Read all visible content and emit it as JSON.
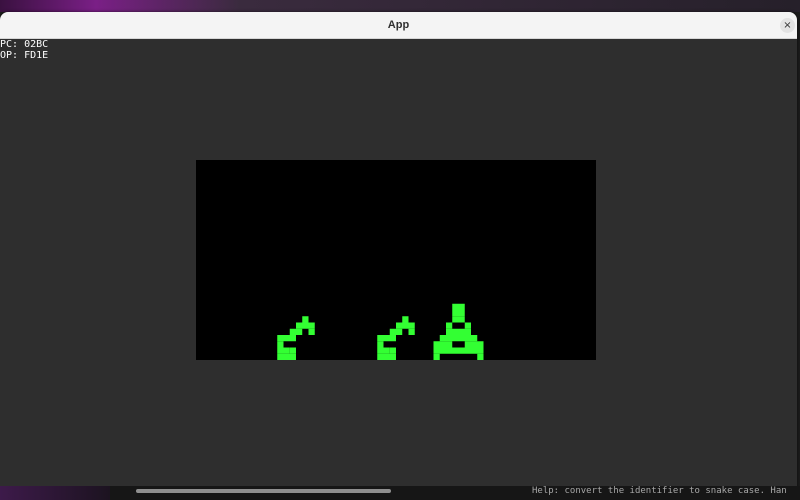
{
  "window": {
    "title": "App",
    "close_icon": "close-icon",
    "close_glyph": "×"
  },
  "debug": {
    "pc_label": "PC: 02BC",
    "op_label": "OP: FD1E"
  },
  "display": {
    "background": "#000000",
    "pixel_color": "#33ff33",
    "sprites": [
      "alien-sprite-left",
      "alien-sprite-middle",
      "player-ship-sprite"
    ]
  },
  "background_app": {
    "partial_text": "Help: convert the identifier to snake case.  Han"
  }
}
